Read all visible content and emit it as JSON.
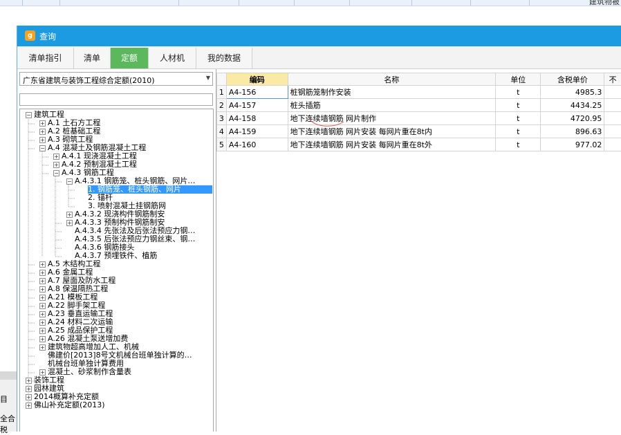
{
  "window": {
    "title": "查询",
    "logo_glyph": "g",
    "accent": "#1d9be2",
    "active_tab_color": "#5bb85d"
  },
  "background": {
    "right_text": "建筑物被",
    "side_text_1": "目",
    "side_text_2": "全合税"
  },
  "tabs": [
    {
      "label": "清单指引"
    },
    {
      "label": "清单"
    },
    {
      "label": "定额",
      "active": true
    },
    {
      "label": "人材机"
    },
    {
      "label": "我的数据"
    }
  ],
  "left": {
    "quota_library": "广东省建筑与装饰工程综合定额(2010)",
    "search_value": ""
  },
  "tree": [
    {
      "label": "建筑工程",
      "toggle": "-"
    },
    {
      "label": "A.1 土石方工程",
      "toggle": "+"
    },
    {
      "label": "A.2 桩基础工程",
      "toggle": "+"
    },
    {
      "label": "A.3 砌筑工程",
      "toggle": "+"
    },
    {
      "label": "A.4 混凝土及钢筋混凝土工程",
      "toggle": "-"
    },
    {
      "label": "A.4.1 现浇混凝土工程",
      "toggle": "+"
    },
    {
      "label": "A.4.2 预制混凝土工程",
      "toggle": "+"
    },
    {
      "label": "A.4.3 钢筋工程",
      "toggle": "-"
    },
    {
      "label": "A.4.3.1 钢筋笼、桩头钢筋、网片…",
      "toggle": "-"
    },
    {
      "label": "1. 钢筋笼、桩头钢筋、网片",
      "selected": true
    },
    {
      "label": "2. 锚杆"
    },
    {
      "label": "3. 喷射混凝土挂钢筋网"
    },
    {
      "label": "A.4.3.2 现浇构件钢筋制安",
      "toggle": "+"
    },
    {
      "label": "A.4.3.3 预制构件钢筋制安",
      "toggle": "+"
    },
    {
      "label": "A.4.3.4 先张法及后张法预应力钢…"
    },
    {
      "label": "A.4.3.5 后张法预应力钢丝束、钢…"
    },
    {
      "label": "A.4.3.6 钢筋接头"
    },
    {
      "label": "A.4.3.7 预埋铁件、植筋"
    },
    {
      "label": "A.5 木结构工程",
      "toggle": "+"
    },
    {
      "label": "A.6 金属工程",
      "toggle": "+"
    },
    {
      "label": "A.7 屋面及防水工程",
      "toggle": "+"
    },
    {
      "label": "A.8 保温隔热工程",
      "toggle": "+"
    },
    {
      "label": "A.21 模板工程",
      "toggle": "+"
    },
    {
      "label": "A.22 脚手架工程",
      "toggle": "+"
    },
    {
      "label": "A.23 垂直运输工程",
      "toggle": "+"
    },
    {
      "label": "A.24 材料二次运输",
      "toggle": "+"
    },
    {
      "label": "A.25 成品保护工程",
      "toggle": "+"
    },
    {
      "label": "A.26 混凝土泵送增加费",
      "toggle": "+"
    },
    {
      "label": "建筑物超高增加人工、机械",
      "toggle": "+"
    },
    {
      "label": "佛建价[2013]8号文机械台班单独计算的…"
    },
    {
      "label": "机械台班单独计算费用"
    },
    {
      "label": "混凝土、砂浆制作含量表",
      "toggle": "+"
    },
    {
      "label": "装饰工程",
      "toggle": "+"
    },
    {
      "label": "园林建筑",
      "toggle": "+"
    },
    {
      "label": "2014概算补充定额",
      "toggle": "+"
    },
    {
      "label": "佛山补充定额(2013)",
      "toggle": "+"
    }
  ],
  "grid": {
    "columns": [
      "",
      "编码",
      "名称",
      "单位",
      "含税单价",
      "不"
    ],
    "rows": [
      {
        "no": "1",
        "code": "A4-156",
        "name": "桩钢筋笼制作安装",
        "unit": "t",
        "price": "4985.3"
      },
      {
        "no": "2",
        "code": "A4-157",
        "name": "桩头插筋",
        "unit": "t",
        "price": "4434.25"
      },
      {
        "no": "3",
        "code": "A4-158",
        "name": "地下连续墙钢筋 网片制作",
        "unit": "t",
        "price": "4720.95"
      },
      {
        "no": "4",
        "code": "A4-159",
        "name": "地下连续墙钢筋 网片安装 每网片重在8t内",
        "unit": "t",
        "price": "896.63"
      },
      {
        "no": "5",
        "code": "A4-160",
        "name": "地下连续墙钢筋 网片安装 每网片重在8t外",
        "unit": "t",
        "price": "977.02"
      }
    ]
  }
}
